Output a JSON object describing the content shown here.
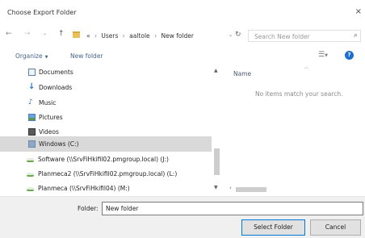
{
  "window": {
    "title": "Choose Export Folder",
    "close_glyph": "×"
  },
  "nav": {
    "back": "←",
    "forward": "→",
    "recent": "⌄",
    "up": "↑",
    "breadcrumbs": [
      "Users",
      "aaltole",
      "New folder"
    ],
    "overflow": "«",
    "separator": "›",
    "refresh": "↻",
    "search_placeholder": "Search New folder",
    "search_icon": "search-icon"
  },
  "toolbar": {
    "organize": "Organize",
    "new_folder": "New folder",
    "view_icon": "view-options-icon",
    "help_glyph": "?"
  },
  "sidebar": {
    "items": [
      {
        "label": "Documents",
        "icon": "documents-icon"
      },
      {
        "label": "Downloads",
        "icon": "downloads-icon"
      },
      {
        "label": "Music",
        "icon": "music-icon"
      },
      {
        "label": "Pictures",
        "icon": "pictures-icon"
      },
      {
        "label": "Videos",
        "icon": "videos-icon"
      },
      {
        "label": "Windows (C:)",
        "icon": "drive-icon",
        "selected": true
      },
      {
        "label": "Software (\\\\SrvFiHkifil02.pmgroup.local) (J:)",
        "icon": "network-drive-icon"
      },
      {
        "label": "Planmeca2 (\\\\SrvFiHkifil02.pmgroup.local) (L:)",
        "icon": "network-drive-icon"
      },
      {
        "label": "Planmeca (\\\\SrvFiHkifil04) (M:)",
        "icon": "network-drive-icon"
      }
    ]
  },
  "content": {
    "column_name": "Name",
    "empty_message": "No items match your search."
  },
  "bottom": {
    "folder_label": "Folder:",
    "folder_value": "New folder",
    "select_button": "Select Folder",
    "cancel_button": "Cancel"
  },
  "colors": {
    "accent": "#0078d7",
    "selected_row": "#d9d9d9",
    "link_text": "#46648c"
  }
}
